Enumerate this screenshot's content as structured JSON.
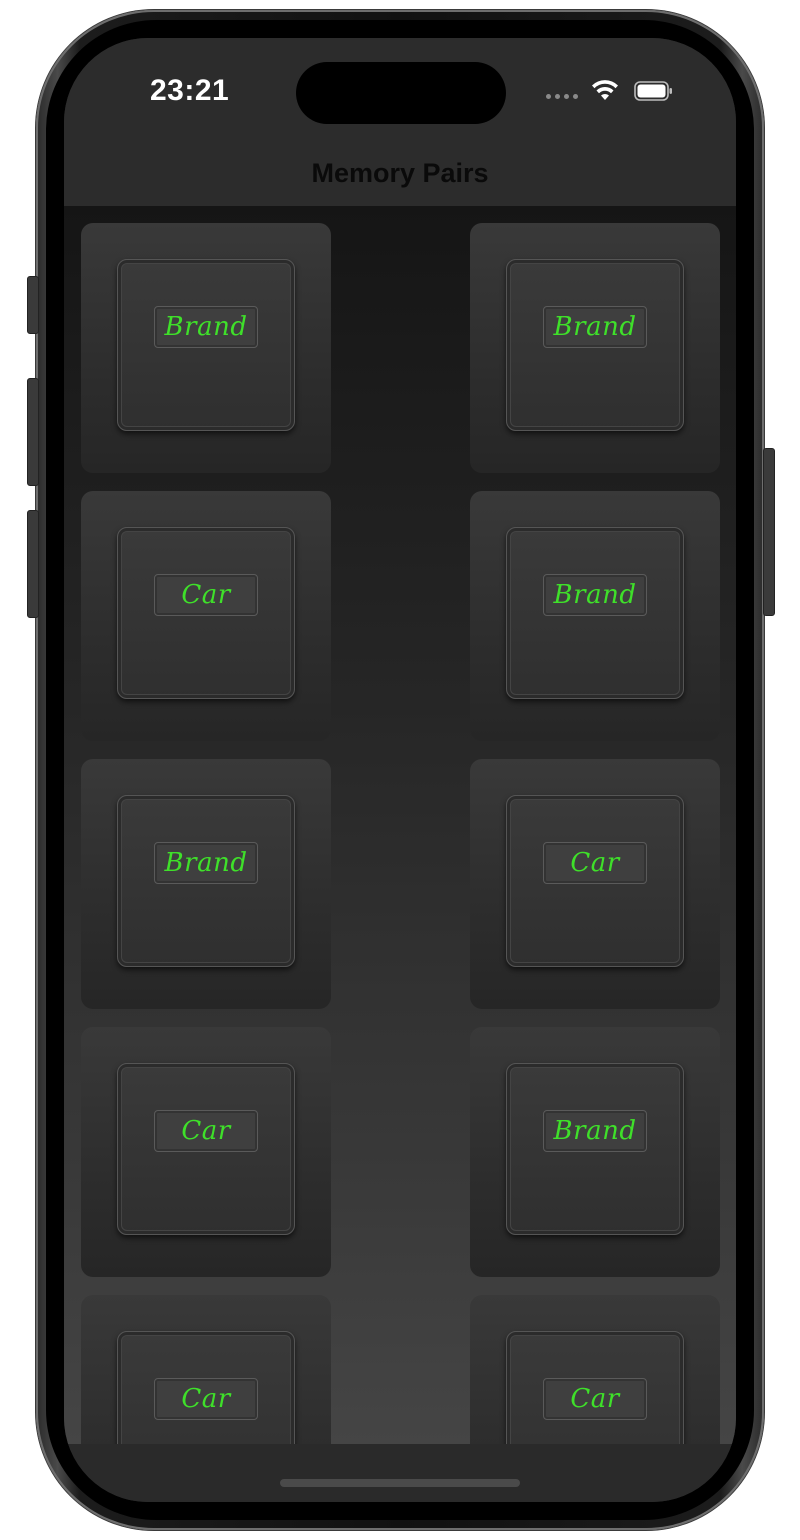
{
  "status_bar": {
    "time": "23:21",
    "icons": [
      "cellular-dots-icon",
      "wifi-icon",
      "battery-icon"
    ]
  },
  "nav": {
    "title": "Memory Pairs"
  },
  "cards": [
    {
      "label": "Brand"
    },
    {
      "label": "Brand"
    },
    {
      "label": "Car"
    },
    {
      "label": "Brand"
    },
    {
      "label": "Brand"
    },
    {
      "label": "Car"
    },
    {
      "label": "Car"
    },
    {
      "label": "Brand"
    },
    {
      "label": "Car"
    },
    {
      "label": "Car"
    }
  ],
  "colors": {
    "label_text": "#3fe02a",
    "card_background": "#333333",
    "nav_title": "#0a0a0a"
  }
}
